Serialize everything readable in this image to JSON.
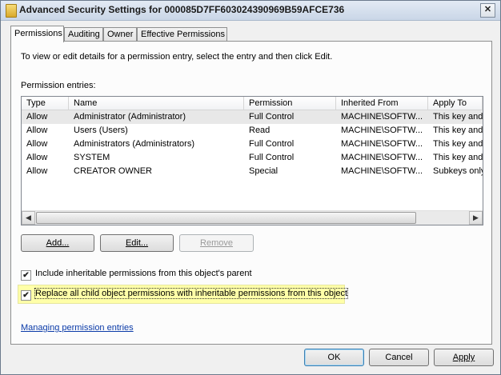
{
  "window": {
    "title": "Advanced Security Settings for 000085D7FF603024390969B59AFCE736",
    "close_glyph": "✕"
  },
  "tabs": [
    {
      "label": "Permissions"
    },
    {
      "label": "Auditing"
    },
    {
      "label": "Owner"
    },
    {
      "label": "Effective Permissions"
    }
  ],
  "permissions": {
    "intro": "To view or edit details for a permission entry, select the entry and then click Edit.",
    "entries_label": "Permission entries:",
    "columns": [
      "Type",
      "Name",
      "Permission",
      "Inherited From",
      "Apply To"
    ],
    "rows": [
      {
        "type": "Allow",
        "name": "Administrator (Administrator)",
        "permission": "Full Control",
        "inherited_from": "MACHINE\\SOFTW...",
        "apply_to": "This key and"
      },
      {
        "type": "Allow",
        "name": "Users (Users)",
        "permission": "Read",
        "inherited_from": "MACHINE\\SOFTW...",
        "apply_to": "This key and"
      },
      {
        "type": "Allow",
        "name": "Administrators (Administrators)",
        "permission": "Full Control",
        "inherited_from": "MACHINE\\SOFTW...",
        "apply_to": "This key and"
      },
      {
        "type": "Allow",
        "name": "SYSTEM",
        "permission": "Full Control",
        "inherited_from": "MACHINE\\SOFTW...",
        "apply_to": "This key and"
      },
      {
        "type": "Allow",
        "name": "CREATOR OWNER",
        "permission": "Special",
        "inherited_from": "MACHINE\\SOFTW...",
        "apply_to": "Subkeys only"
      }
    ],
    "buttons": {
      "add": "Add...",
      "edit": "Edit...",
      "remove": "Remove"
    },
    "include_inheritable": {
      "label": "Include inheritable permissions from this object's parent",
      "checked": true
    },
    "replace_child": {
      "label": "Replace all child object permissions with inheritable permissions from this object",
      "checked": true
    },
    "help_link": "Managing permission entries"
  },
  "footer": {
    "ok": "OK",
    "cancel": "Cancel",
    "apply": "Apply"
  },
  "check_glyph": "✔",
  "scroll": {
    "left": "◀",
    "right": "▶"
  }
}
